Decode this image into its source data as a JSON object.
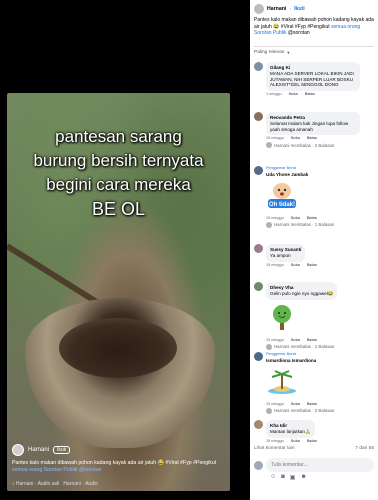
{
  "video": {
    "overlay_lines": [
      "pantesan sarang",
      "burung bersih ternyata",
      "begini cara mereka",
      "BE OL"
    ],
    "author": "Harnani",
    "follow_label": "Ikuti",
    "caption": "Pantes kalo makan dibawah pohon kadang kayak ada air jatuh 😂 #Viral #Fyp #Pengikut",
    "caption_link": "semua orang Sorotan Publik",
    "caption_tag": "@sorotan",
    "audio": "Harnani · Audio asli",
    "audio_right": "Harnani · Audio"
  },
  "post": {
    "author": "Harnani",
    "follow_label": "Ikuti",
    "caption": "Pantes kalo makan dibawah pohon kadang kayak ada air jatuh 😂 #Viral #Fyp #Pengikut",
    "caption_link": "semua orang Sorotan Publik",
    "caption_tag": "@sorotan",
    "sort_label": "Paling relevan"
  },
  "comments": [
    {
      "name": "Gilang Ki",
      "text": "MANA ADA SERVER LOKAL BIKIN JADI JUTAWAN, NIH SERPER LUAR BOSKU ALEXIST*GEL SENGGOL DONG",
      "time": "1 minggu",
      "like": "Suka",
      "reply": "Balas"
    },
    {
      "name": "Reovando Petra",
      "text": "Selamat malam kak Jingan lupa follow yaah smoga amanah",
      "time": "15 minggu",
      "like": "Suka",
      "reply": "Balas",
      "replies": "Harnani membalas · 2 Balasan"
    },
    {
      "name": "Uda Yhone Jambak",
      "badge": "Penggemar Berat",
      "sticker_text": "Oh tidak!",
      "time": "15 minggu",
      "like": "Suka",
      "reply": "Balas",
      "replies": "Harnani membalas · 1 Balasan"
    },
    {
      "name": "Sussy Susanti",
      "text": "Ya ampun",
      "time": "15 minggu",
      "like": "Suka",
      "reply": "Balas"
    },
    {
      "name": "Dhesy Vha",
      "text": "Gelin pulo ngie nyo nggawel😂",
      "time": "15 minggu",
      "like": "Suka",
      "reply": "Balas",
      "replies": "Harnani membalas · 1 Balasan"
    },
    {
      "name": "Ismardiona Ismardiona",
      "badge": "Penggemar Berat",
      "time": "15 minggu",
      "like": "Suka",
      "reply": "Balas",
      "replies": "Harnani membalas · 2 Balasan"
    },
    {
      "name": "Kha Idir",
      "text": "Mantan lanjutkan🙏",
      "time": "15 minggu",
      "like": "Suka",
      "reply": "Balas"
    }
  ],
  "more_comments": "Lihat komentar lain",
  "count": "7 dari 55",
  "input_placeholder": "Tulis komentar..."
}
